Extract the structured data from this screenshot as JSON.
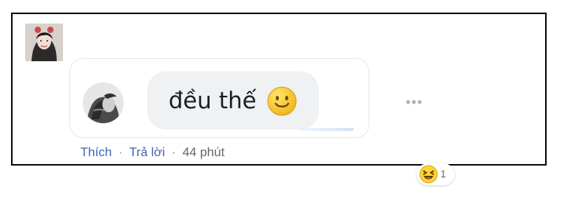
{
  "comment": {
    "text": "đều thế",
    "reaction_count": "1"
  },
  "actions": {
    "like": "Thích",
    "separator_1": "·",
    "reply": "Trả lời",
    "separator_2": "·",
    "time": "44 phút"
  },
  "menu": {
    "more_label": "•••"
  },
  "icons": {
    "avatar": "user-avatar",
    "mini_avatar": "profile-avatar",
    "emoji": "smile-emoji-icon",
    "reaction": "laugh-reaction-icon",
    "more": "more-options-icon"
  },
  "colors": {
    "link": "#4267b2",
    "meta": "#65676b",
    "bubble": "#eff1f3"
  }
}
